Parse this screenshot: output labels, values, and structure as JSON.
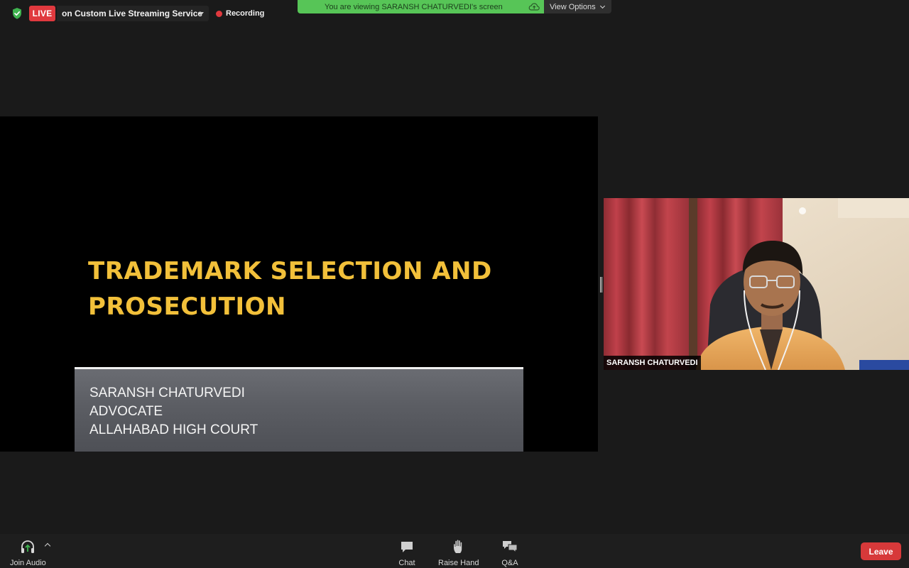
{
  "topbar": {
    "live_label": "LIVE",
    "stream_service": "on Custom Live Streaming Service",
    "recording_label": "Recording",
    "viewing_notice": "You are viewing SARANSH CHATURVEDI's screen",
    "view_options_label": "View Options",
    "icons": {
      "security": "shield-check-icon",
      "cloud": "cloud-upload-icon"
    }
  },
  "slide": {
    "title_lines": [
      "TRADEMARK SELECTION AND",
      "PROSECUTION"
    ],
    "subtitle_lines": [
      "SARANSH CHATURVEDI",
      "ADVOCATE",
      "ALLAHABAD HIGH COURT"
    ]
  },
  "participant": {
    "name": "SARANSH CHATURVEDI"
  },
  "toolbar": {
    "join_audio_label": "Join Audio",
    "chat_label": "Chat",
    "raise_hand_label": "Raise Hand",
    "qa_label": "Q&A",
    "leave_label": "Leave"
  },
  "colors": {
    "live_red": "#e0393e",
    "viewing_green": "#57c557",
    "slide_title_gold": "#f2c03a",
    "leave_red": "#d7393a"
  }
}
